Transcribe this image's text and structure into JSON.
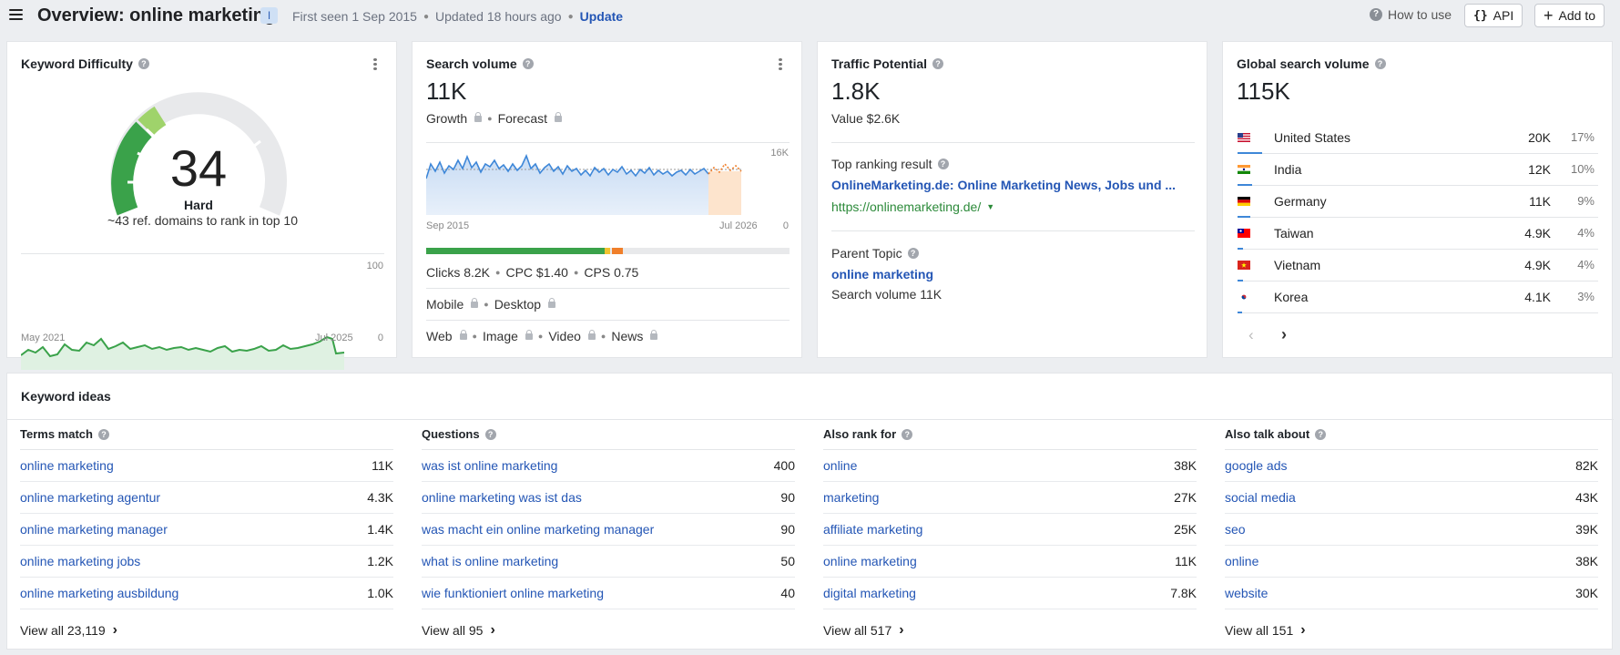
{
  "header": {
    "title": "Overview: online marketing",
    "info_badge": "I",
    "first_seen": "First seen 1 Sep 2015",
    "updated": "Updated 18 hours ago",
    "update_label": "Update",
    "how_to_use": "How to use",
    "api_label": "API",
    "add_to_label": "Add to"
  },
  "keyword_difficulty": {
    "title": "Keyword Difficulty",
    "score": "34",
    "score_value": 34,
    "label": "Hard",
    "desc": "~43 ref. domains to rank in top 10",
    "chart_start": "May 2021",
    "chart_end": "Jul 2025",
    "chart_max": "100",
    "chart_min": "0"
  },
  "search_volume": {
    "title": "Search volume",
    "value": "11K",
    "growth": "Growth",
    "forecast": "Forecast",
    "chart_start": "Sep 2015",
    "chart_end": "Jul 2026",
    "chart_max": "16K",
    "chart_min": "0",
    "clicks": "Clicks 8.2K",
    "cpc": "CPC $1.40",
    "cps": "CPS 0.75",
    "mobile": "Mobile",
    "desktop": "Desktop",
    "web": "Web",
    "image": "Image",
    "video": "Video",
    "news": "News"
  },
  "traffic_potential": {
    "title": "Traffic Potential",
    "value": "1.8K",
    "value_usd": "Value $2.6K",
    "top_result_label": "Top ranking result",
    "top_result_title": "OnlineMarketing.de: Online Marketing News, Jobs und ...",
    "top_result_url": "https://onlinemarketing.de/",
    "parent_topic_label": "Parent Topic",
    "parent_topic": "online marketing",
    "parent_volume": "Search volume 11K"
  },
  "global_volume": {
    "title": "Global search volume",
    "value": "115K",
    "countries": [
      {
        "name": "United States",
        "volume": "20K",
        "pct": "17%",
        "share": 0.17
      },
      {
        "name": "India",
        "volume": "12K",
        "pct": "10%",
        "share": 0.1
      },
      {
        "name": "Germany",
        "volume": "11K",
        "pct": "9%",
        "share": 0.09
      },
      {
        "name": "Taiwan",
        "volume": "4.9K",
        "pct": "4%",
        "share": 0.04
      },
      {
        "name": "Vietnam",
        "volume": "4.9K",
        "pct": "4%",
        "share": 0.04
      },
      {
        "name": "Korea",
        "volume": "4.1K",
        "pct": "3%",
        "share": 0.03
      }
    ]
  },
  "keyword_ideas": {
    "title": "Keyword ideas",
    "columns": [
      {
        "heading": "Terms match",
        "view_all": "View all 23,119",
        "rows": [
          {
            "kw": "online marketing",
            "v": "11K"
          },
          {
            "kw": "online marketing agentur",
            "v": "4.3K"
          },
          {
            "kw": "online marketing manager",
            "v": "1.4K"
          },
          {
            "kw": "online marketing jobs",
            "v": "1.2K"
          },
          {
            "kw": "online marketing ausbildung",
            "v": "1.0K"
          }
        ]
      },
      {
        "heading": "Questions",
        "view_all": "View all 95",
        "rows": [
          {
            "kw": "was ist online marketing",
            "v": "400"
          },
          {
            "kw": "online marketing was ist das",
            "v": "90"
          },
          {
            "kw": "was macht ein online marketing manager",
            "v": "90"
          },
          {
            "kw": "what is online marketing",
            "v": "50"
          },
          {
            "kw": "wie funktioniert online marketing",
            "v": "40"
          }
        ]
      },
      {
        "heading": "Also rank for",
        "view_all": "View all 517",
        "rows": [
          {
            "kw": "online",
            "v": "38K"
          },
          {
            "kw": "marketing",
            "v": "27K"
          },
          {
            "kw": "affiliate marketing",
            "v": "25K"
          },
          {
            "kw": "online marketing",
            "v": "11K"
          },
          {
            "kw": "digital marketing",
            "v": "7.8K"
          }
        ]
      },
      {
        "heading": "Also talk about",
        "view_all": "View all 151",
        "rows": [
          {
            "kw": "google ads",
            "v": "82K"
          },
          {
            "kw": "social media",
            "v": "43K"
          },
          {
            "kw": "seo",
            "v": "39K"
          },
          {
            "kw": "online",
            "v": "38K"
          },
          {
            "kw": "website",
            "v": "30K"
          }
        ]
      }
    ]
  },
  "colors": {
    "link": "#2456b5",
    "accent_blue": "#3e87d8",
    "green": "#3aa24a",
    "orange": "#f07f2a"
  }
}
